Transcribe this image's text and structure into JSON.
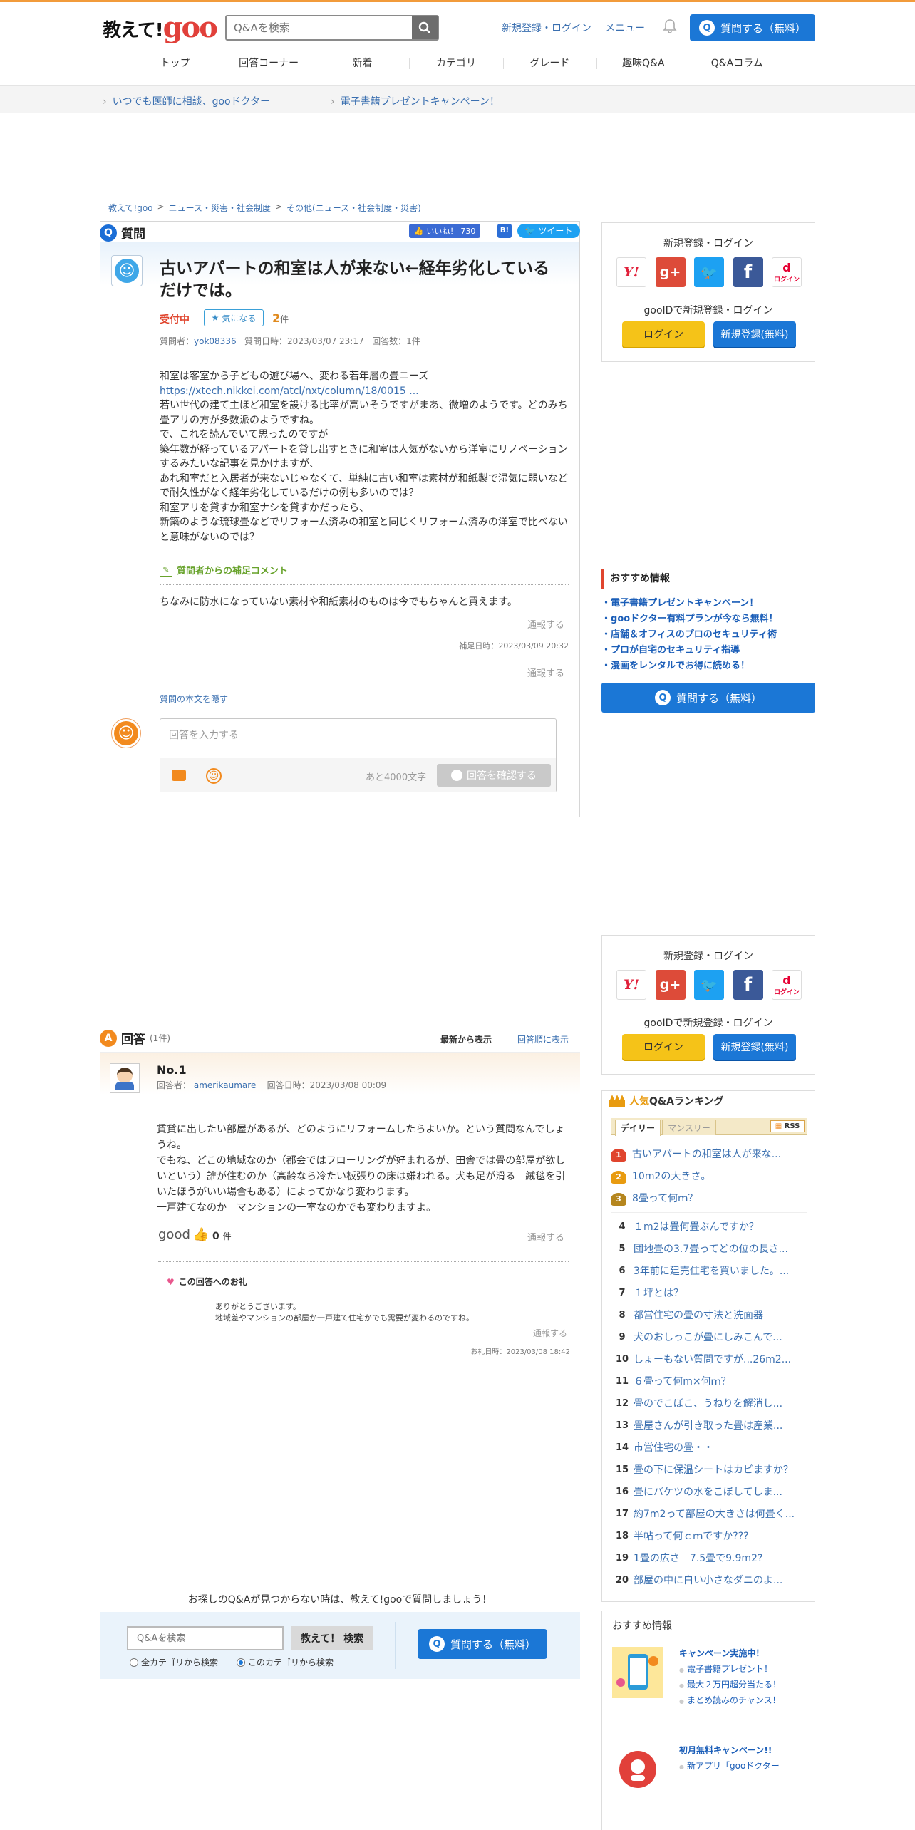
{
  "header": {
    "logo_text": "教えて!",
    "logo_goo": "goo",
    "search_placeholder": "Q&Aを検索",
    "login_link": "新規登録・ログイン",
    "menu_link": "メニュー",
    "ask_button": "質問する（無料）",
    "nav": [
      "トップ",
      "回答コーナー",
      "新着",
      "カテゴリ",
      "グレード",
      "趣味Q&A",
      "Q&Aコラム"
    ]
  },
  "subbar": {
    "link1": "いつでも医師に相談、gooドクター",
    "link2": "電子書籍プレゼントキャンペーン！"
  },
  "breadcrumb": [
    "教えて!goo",
    "ニュース・災害・社会制度",
    "その他(ニュース・社会制度・災害)"
  ],
  "question": {
    "section_label": "質問",
    "like_label": "いいね！",
    "like_count": "730",
    "hatena_label": "B!",
    "tweet_label": "ツイート",
    "title": "古いアパートの和室は人が来ない←経年劣化しているだけでは。",
    "status": "受付中",
    "kininaru_label": "気になる",
    "kininaru_count": "2",
    "kininaru_unit": "件",
    "meta_asker_label": "質問者：",
    "meta_asker": "yok08336",
    "meta_date": "質問日時：2023/03/07 23:17",
    "meta_answers": "回答数：1件",
    "body": [
      "和室は客室から子どもの遊び場へ、変わる若年層の畳ニーズ",
      "https://xtech.nikkei.com/atcl/nxt/column/18/0015 ...",
      "若い世代の建て主ほど和室を設ける比率が高いそうですがまあ、微増のようです。どのみち畳アリの方が多数派のようですね。",
      "で、これを読んでいて思ったのですが",
      "築年数が経っているアパートを貸し出すときに和室は人気がないから洋室にリノベーションするみたいな記事を見かけますが、",
      "あれ和室だと入居者が来ないじゃなくて、単純に古い和室は素材が和紙製で湿気に弱いなどで耐久性がなく経年劣化しているだけの例も多いのでは？",
      "和室アリを貸すか和室ナシを貸すかだったら、",
      "新築のような琉球畳などでリフォーム済みの和室と同じくリフォーム済みの洋室で比べないと意味がないのでは？"
    ],
    "supplement_label": "質問者からの補足コメント",
    "supplement_text": "ちなみに防水になっていない素材や和紙素材のものは今でもちゃんと買えます。",
    "report_label": "通報する",
    "supplement_date": "補足日時：2023/03/09 20:32",
    "hide_body": "質問の本文を隠す",
    "answer_placeholder": "回答を入力する",
    "remaining": "あと4000文字",
    "confirm_button": "回答を確認する"
  },
  "side_login": {
    "title": "新規登録・ログイン",
    "goo_id": "gooIDで新規登録・ログイン",
    "login_button": "ログイン",
    "register_button": "新規登録(無料)",
    "sns": [
      "Y!",
      "g+",
      "twitter",
      "f",
      "d"
    ],
    "docomo_label": "ログイン"
  },
  "recommend": {
    "title": "おすすめ情報",
    "items": [
      "電子書籍プレゼントキャンペーン！",
      "gooドクター有料プランが今なら無料！",
      "店舗＆オフィスのプロのセキュリティ術",
      "プロが自宅のセキュリティ指導",
      "漫画をレンタルでお得に読める！"
    ],
    "ask_button": "質問する（無料）"
  },
  "answers": {
    "section_label": "回答",
    "count": "(1件)",
    "sort_newest": "最新から表示",
    "sort_order": "回答順に表示",
    "items": [
      {
        "no": "No.1",
        "answerer_label": "回答者：",
        "answerer": "amerikaumare",
        "date": "回答日時：2023/03/08 00:09",
        "body": [
          "賃貸に出したい部屋があるが、どのようにリフォームしたらよいか。という質問なんでしょうね。",
          "でもね、どこの地域なのか（都会ではフローリングが好まれるが、田舎では畳の部屋が欲しいという）誰が住むのか（高齢なら冷たい板張りの床は嫌われる。犬も足が滑る　絨毯を引いたほうがいい場合もある）によってかなり変わります。",
          "一戸建てなのか　マンションの一室なのかでも変わりますよ。"
        ],
        "good_label": "good",
        "good_count": "0",
        "good_unit": "件",
        "report_label": "通報する",
        "thanks_label": "この回答へのお礼",
        "thanks_text": [
          "ありがとうございます。",
          "地域差やマンションの部屋か一戸建て住宅かでも需要が変わるのですね。"
        ],
        "thanks_report": "通報する",
        "thanks_date": "お礼日時：2023/03/08 18:42"
      }
    ]
  },
  "bottom": {
    "not_found": "お探しのQ&Aが見つからない時は、教えて!gooで質問しましょう！",
    "search_placeholder": "Q&Aを検索",
    "search_button": "教えて！ 検索",
    "radio_all": "全カテゴリから検索",
    "radio_this": "このカテゴリから検索",
    "ask_button": "質問する（無料）"
  },
  "ranking": {
    "title_hot": "人気",
    "title_rest": "Q&Aランキング",
    "tab_daily": "デイリー",
    "tab_monthly": "マンスリー",
    "rss": "RSS",
    "items": [
      {
        "rank": "1",
        "title": "古いアパートの和室は人が来な..."
      },
      {
        "rank": "2",
        "title": "10m2の大きさ。"
      },
      {
        "rank": "3",
        "title": "8畳って何ｍ？"
      },
      {
        "rank": "4",
        "title": "１m2は畳何畳ぶんですか？"
      },
      {
        "rank": "5",
        "title": "団地畳の3.7畳ってどの位の長さ..."
      },
      {
        "rank": "6",
        "title": "3年前に建売住宅を買いました。..."
      },
      {
        "rank": "7",
        "title": "１坪とは？"
      },
      {
        "rank": "8",
        "title": "都営住宅の畳の寸法と洗面器"
      },
      {
        "rank": "9",
        "title": "犬のおしっこが畳にしみこんで..."
      },
      {
        "rank": "10",
        "title": "しょーもない質問ですが...26m2..."
      },
      {
        "rank": "11",
        "title": "６畳って何m×何ｍ？"
      },
      {
        "rank": "12",
        "title": "畳のでこぼこ、うねりを解消し..."
      },
      {
        "rank": "13",
        "title": "畳屋さんが引き取った畳は産業..."
      },
      {
        "rank": "14",
        "title": "市営住宅の畳・・"
      },
      {
        "rank": "15",
        "title": "畳の下に保温シートはカビますか？"
      },
      {
        "rank": "16",
        "title": "畳にバケツの水をこぼしてしま..."
      },
      {
        "rank": "17",
        "title": "約7m2って部屋の大きさは何畳く..."
      },
      {
        "rank": "18",
        "title": "半帖って何ｃｍですか???"
      },
      {
        "rank": "19",
        "title": "1畳の広さ　7.5畳で9.9m2?"
      },
      {
        "rank": "20",
        "title": "部屋の中に白い小さなダニのよ..."
      }
    ]
  },
  "recommend2": {
    "title": "おすすめ情報",
    "promo1_title": "キャンペーン実施中！",
    "promo1_items": [
      "電子書籍プレゼント！",
      "最大２万円超分当たる！",
      "まとめ読みのチャンス！"
    ],
    "promo2_title": "初月無料キャンペーン!!",
    "promo2_items": [
      "新アプリ「gooドクター"
    ]
  },
  "colors": {
    "accent": "#1b77d6",
    "orange": "#f28a1e",
    "brand_red": "#e1403a"
  }
}
